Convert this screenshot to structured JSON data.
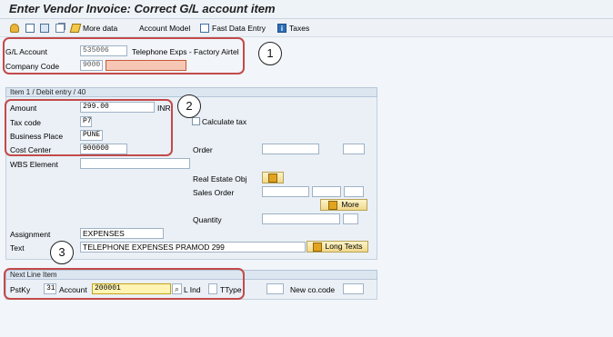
{
  "window": {
    "title": "Enter Vendor Invoice: Correct G/L account item"
  },
  "toolbar": {
    "more_data": "More data",
    "account_model": "Account Model",
    "fast_data_entry": "Fast Data Entry",
    "taxes": "Taxes"
  },
  "header": {
    "gl_account_label": "G/L Account",
    "gl_account_value": "535006",
    "gl_account_desc": "Telephone Exps - Factory Airtel",
    "company_code_label": "Company Code",
    "company_code_value": "9000",
    "company_code_name": ""
  },
  "item": {
    "section_title": "Item 1 / Debit entry / 40",
    "amount_label": "Amount",
    "amount_value": "299.00",
    "currency": "INR",
    "calculate_tax_label": "Calculate tax",
    "tax_code_label": "Tax code",
    "tax_code_value": "P7",
    "business_place_label": "Business Place",
    "business_place_value": "PUNE",
    "cost_center_label": "Cost Center",
    "cost_center_value": "900000",
    "order_label": "Order",
    "wbs_label": "WBS Element",
    "real_estate_label": "Real Estate Obj",
    "sales_order_label": "Sales Order",
    "more_button": "More",
    "quantity_label": "Quantity",
    "assignment_label": "Assignment",
    "assignment_value": "EXPENSES",
    "text_label": "Text",
    "text_value": "TELEPHONE EXPENSES PRAMOD 299",
    "long_texts_button": "Long Texts"
  },
  "next_line": {
    "section_title": "Next Line Item",
    "pstky_label": "PstKy",
    "pstky_value": "31",
    "account_label": "Account",
    "account_value": "200001",
    "l_ind_label": "L Ind",
    "ttype_label": "TType",
    "new_co_code_label": "New co.code"
  },
  "annotations": {
    "one": "1",
    "two": "2",
    "three": "3"
  },
  "colors": {
    "annotation_box": "#c24a4a",
    "error_field": "#f7c7b5",
    "focus_field": "#fff4b3"
  },
  "icons": [
    "person-icon",
    "new-doc-icon",
    "doc-icon",
    "copy-icon",
    "pencil-icon",
    "fast-entry-icon",
    "info-icon"
  ]
}
